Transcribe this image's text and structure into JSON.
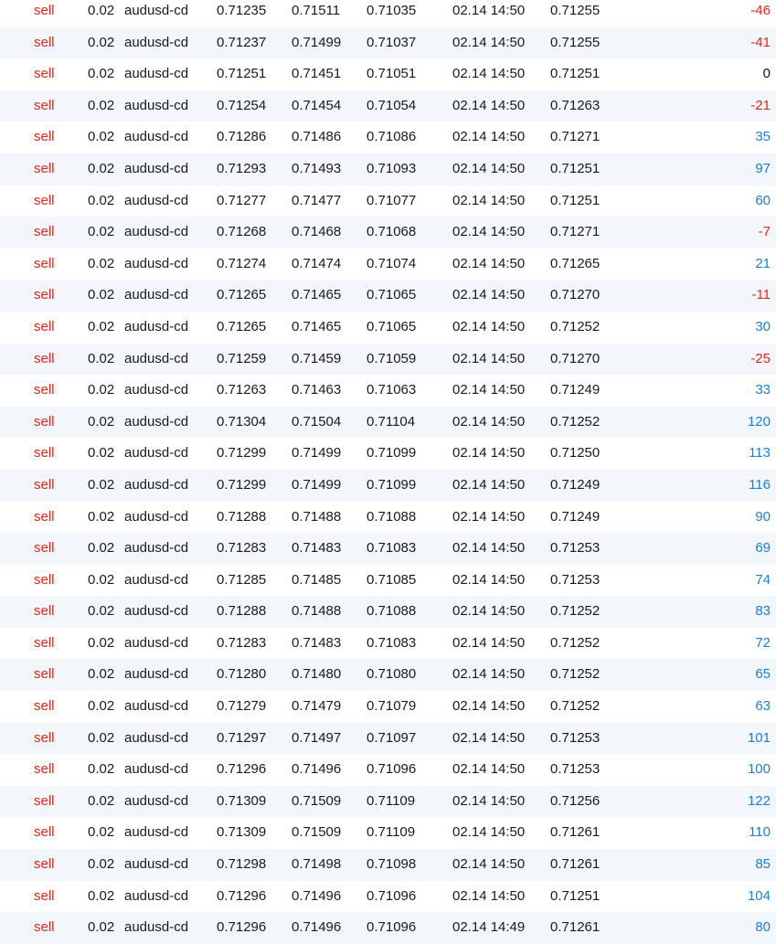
{
  "colors": {
    "sell": "#e2271b",
    "negative_profit": "#e2271b",
    "positive_profit": "#1a7fd6",
    "alt_row_background": "#f3f6fb"
  },
  "trades": [
    {
      "type": "sell",
      "lots": "0.02",
      "symbol": "audusd-cd",
      "open_price": "0.71235",
      "take_profit": "0.71511",
      "stop_loss": "0.71035",
      "time": "02.14 14:50",
      "current_price": "0.71255",
      "profit": "-46"
    },
    {
      "type": "sell",
      "lots": "0.02",
      "symbol": "audusd-cd",
      "open_price": "0.71237",
      "take_profit": "0.71499",
      "stop_loss": "0.71037",
      "time": "02.14 14:50",
      "current_price": "0.71255",
      "profit": "-41"
    },
    {
      "type": "sell",
      "lots": "0.02",
      "symbol": "audusd-cd",
      "open_price": "0.71251",
      "take_profit": "0.71451",
      "stop_loss": "0.71051",
      "time": "02.14 14:50",
      "current_price": "0.71251",
      "profit": "0"
    },
    {
      "type": "sell",
      "lots": "0.02",
      "symbol": "audusd-cd",
      "open_price": "0.71254",
      "take_profit": "0.71454",
      "stop_loss": "0.71054",
      "time": "02.14 14:50",
      "current_price": "0.71263",
      "profit": "-21"
    },
    {
      "type": "sell",
      "lots": "0.02",
      "symbol": "audusd-cd",
      "open_price": "0.71286",
      "take_profit": "0.71486",
      "stop_loss": "0.71086",
      "time": "02.14 14:50",
      "current_price": "0.71271",
      "profit": "35"
    },
    {
      "type": "sell",
      "lots": "0.02",
      "symbol": "audusd-cd",
      "open_price": "0.71293",
      "take_profit": "0.71493",
      "stop_loss": "0.71093",
      "time": "02.14 14:50",
      "current_price": "0.71251",
      "profit": "97"
    },
    {
      "type": "sell",
      "lots": "0.02",
      "symbol": "audusd-cd",
      "open_price": "0.71277",
      "take_profit": "0.71477",
      "stop_loss": "0.71077",
      "time": "02.14 14:50",
      "current_price": "0.71251",
      "profit": "60"
    },
    {
      "type": "sell",
      "lots": "0.02",
      "symbol": "audusd-cd",
      "open_price": "0.71268",
      "take_profit": "0.71468",
      "stop_loss": "0.71068",
      "time": "02.14 14:50",
      "current_price": "0.71271",
      "profit": "-7"
    },
    {
      "type": "sell",
      "lots": "0.02",
      "symbol": "audusd-cd",
      "open_price": "0.71274",
      "take_profit": "0.71474",
      "stop_loss": "0.71074",
      "time": "02.14 14:50",
      "current_price": "0.71265",
      "profit": "21"
    },
    {
      "type": "sell",
      "lots": "0.02",
      "symbol": "audusd-cd",
      "open_price": "0.71265",
      "take_profit": "0.71465",
      "stop_loss": "0.71065",
      "time": "02.14 14:50",
      "current_price": "0.71270",
      "profit": "-11"
    },
    {
      "type": "sell",
      "lots": "0.02",
      "symbol": "audusd-cd",
      "open_price": "0.71265",
      "take_profit": "0.71465",
      "stop_loss": "0.71065",
      "time": "02.14 14:50",
      "current_price": "0.71252",
      "profit": "30"
    },
    {
      "type": "sell",
      "lots": "0.02",
      "symbol": "audusd-cd",
      "open_price": "0.71259",
      "take_profit": "0.71459",
      "stop_loss": "0.71059",
      "time": "02.14 14:50",
      "current_price": "0.71270",
      "profit": "-25"
    },
    {
      "type": "sell",
      "lots": "0.02",
      "symbol": "audusd-cd",
      "open_price": "0.71263",
      "take_profit": "0.71463",
      "stop_loss": "0.71063",
      "time": "02.14 14:50",
      "current_price": "0.71249",
      "profit": "33"
    },
    {
      "type": "sell",
      "lots": "0.02",
      "symbol": "audusd-cd",
      "open_price": "0.71304",
      "take_profit": "0.71504",
      "stop_loss": "0.71104",
      "time": "02.14 14:50",
      "current_price": "0.71252",
      "profit": "120"
    },
    {
      "type": "sell",
      "lots": "0.02",
      "symbol": "audusd-cd",
      "open_price": "0.71299",
      "take_profit": "0.71499",
      "stop_loss": "0.71099",
      "time": "02.14 14:50",
      "current_price": "0.71250",
      "profit": "113"
    },
    {
      "type": "sell",
      "lots": "0.02",
      "symbol": "audusd-cd",
      "open_price": "0.71299",
      "take_profit": "0.71499",
      "stop_loss": "0.71099",
      "time": "02.14 14:50",
      "current_price": "0.71249",
      "profit": "116"
    },
    {
      "type": "sell",
      "lots": "0.02",
      "symbol": "audusd-cd",
      "open_price": "0.71288",
      "take_profit": "0.71488",
      "stop_loss": "0.71088",
      "time": "02.14 14:50",
      "current_price": "0.71249",
      "profit": "90"
    },
    {
      "type": "sell",
      "lots": "0.02",
      "symbol": "audusd-cd",
      "open_price": "0.71283",
      "take_profit": "0.71483",
      "stop_loss": "0.71083",
      "time": "02.14 14:50",
      "current_price": "0.71253",
      "profit": "69"
    },
    {
      "type": "sell",
      "lots": "0.02",
      "symbol": "audusd-cd",
      "open_price": "0.71285",
      "take_profit": "0.71485",
      "stop_loss": "0.71085",
      "time": "02.14 14:50",
      "current_price": "0.71253",
      "profit": "74"
    },
    {
      "type": "sell",
      "lots": "0.02",
      "symbol": "audusd-cd",
      "open_price": "0.71288",
      "take_profit": "0.71488",
      "stop_loss": "0.71088",
      "time": "02.14 14:50",
      "current_price": "0.71252",
      "profit": "83"
    },
    {
      "type": "sell",
      "lots": "0.02",
      "symbol": "audusd-cd",
      "open_price": "0.71283",
      "take_profit": "0.71483",
      "stop_loss": "0.71083",
      "time": "02.14 14:50",
      "current_price": "0.71252",
      "profit": "72"
    },
    {
      "type": "sell",
      "lots": "0.02",
      "symbol": "audusd-cd",
      "open_price": "0.71280",
      "take_profit": "0.71480",
      "stop_loss": "0.71080",
      "time": "02.14 14:50",
      "current_price": "0.71252",
      "profit": "65"
    },
    {
      "type": "sell",
      "lots": "0.02",
      "symbol": "audusd-cd",
      "open_price": "0.71279",
      "take_profit": "0.71479",
      "stop_loss": "0.71079",
      "time": "02.14 14:50",
      "current_price": "0.71252",
      "profit": "63"
    },
    {
      "type": "sell",
      "lots": "0.02",
      "symbol": "audusd-cd",
      "open_price": "0.71297",
      "take_profit": "0.71497",
      "stop_loss": "0.71097",
      "time": "02.14 14:50",
      "current_price": "0.71253",
      "profit": "101"
    },
    {
      "type": "sell",
      "lots": "0.02",
      "symbol": "audusd-cd",
      "open_price": "0.71296",
      "take_profit": "0.71496",
      "stop_loss": "0.71096",
      "time": "02.14 14:50",
      "current_price": "0.71253",
      "profit": "100"
    },
    {
      "type": "sell",
      "lots": "0.02",
      "symbol": "audusd-cd",
      "open_price": "0.71309",
      "take_profit": "0.71509",
      "stop_loss": "0.71109",
      "time": "02.14 14:50",
      "current_price": "0.71256",
      "profit": "122"
    },
    {
      "type": "sell",
      "lots": "0.02",
      "symbol": "audusd-cd",
      "open_price": "0.71309",
      "take_profit": "0.71509",
      "stop_loss": "0.71109",
      "time": "02.14 14:50",
      "current_price": "0.71261",
      "profit": "110"
    },
    {
      "type": "sell",
      "lots": "0.02",
      "symbol": "audusd-cd",
      "open_price": "0.71298",
      "take_profit": "0.71498",
      "stop_loss": "0.71098",
      "time": "02.14 14:50",
      "current_price": "0.71261",
      "profit": "85"
    },
    {
      "type": "sell",
      "lots": "0.02",
      "symbol": "audusd-cd",
      "open_price": "0.71296",
      "take_profit": "0.71496",
      "stop_loss": "0.71096",
      "time": "02.14 14:50",
      "current_price": "0.71251",
      "profit": "104"
    },
    {
      "type": "sell",
      "lots": "0.02",
      "symbol": "audusd-cd",
      "open_price": "0.71296",
      "take_profit": "0.71496",
      "stop_loss": "0.71096",
      "time": "02.14 14:49",
      "current_price": "0.71261",
      "profit": "80"
    }
  ]
}
